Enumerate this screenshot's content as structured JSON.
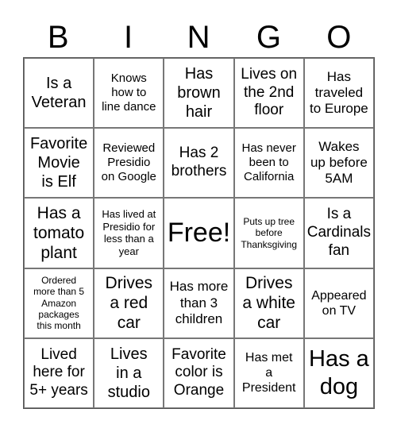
{
  "header": [
    "B",
    "I",
    "N",
    "G",
    "O"
  ],
  "cells": [
    [
      "Is a\nVeteran",
      "Knows\nhow to\nline dance",
      "Has\nbrown\nhair",
      "Lives on\nthe 2nd\nfloor",
      "Has\ntraveled\nto Europe"
    ],
    [
      "Favorite\nMovie\nis Elf",
      "Reviewed\nPresidio\non Google",
      "Has 2\nbrothers",
      "Has never\nbeen to\nCalifornia",
      "Wakes\nup before\n5AM"
    ],
    [
      "Has a\ntomato\nplant",
      "Has lived at\nPresidio for\nless than a\nyear",
      "Free!",
      "Puts up tree\nbefore\nThanksgiving",
      "Is a\nCardinals\nfan"
    ],
    [
      "Ordered\nmore than 5\nAmazon\npackages\nthis month",
      "Drives\na red\ncar",
      "Has more\nthan 3\nchildren",
      "Drives\na white\ncar",
      "Appeared\non TV"
    ],
    [
      "Lived\nhere for\n5+ years",
      "Lives\nin a\nstudio",
      "Favorite\ncolor is\nOrange",
      "Has met\na\nPresident",
      "Has a\ndog"
    ]
  ]
}
